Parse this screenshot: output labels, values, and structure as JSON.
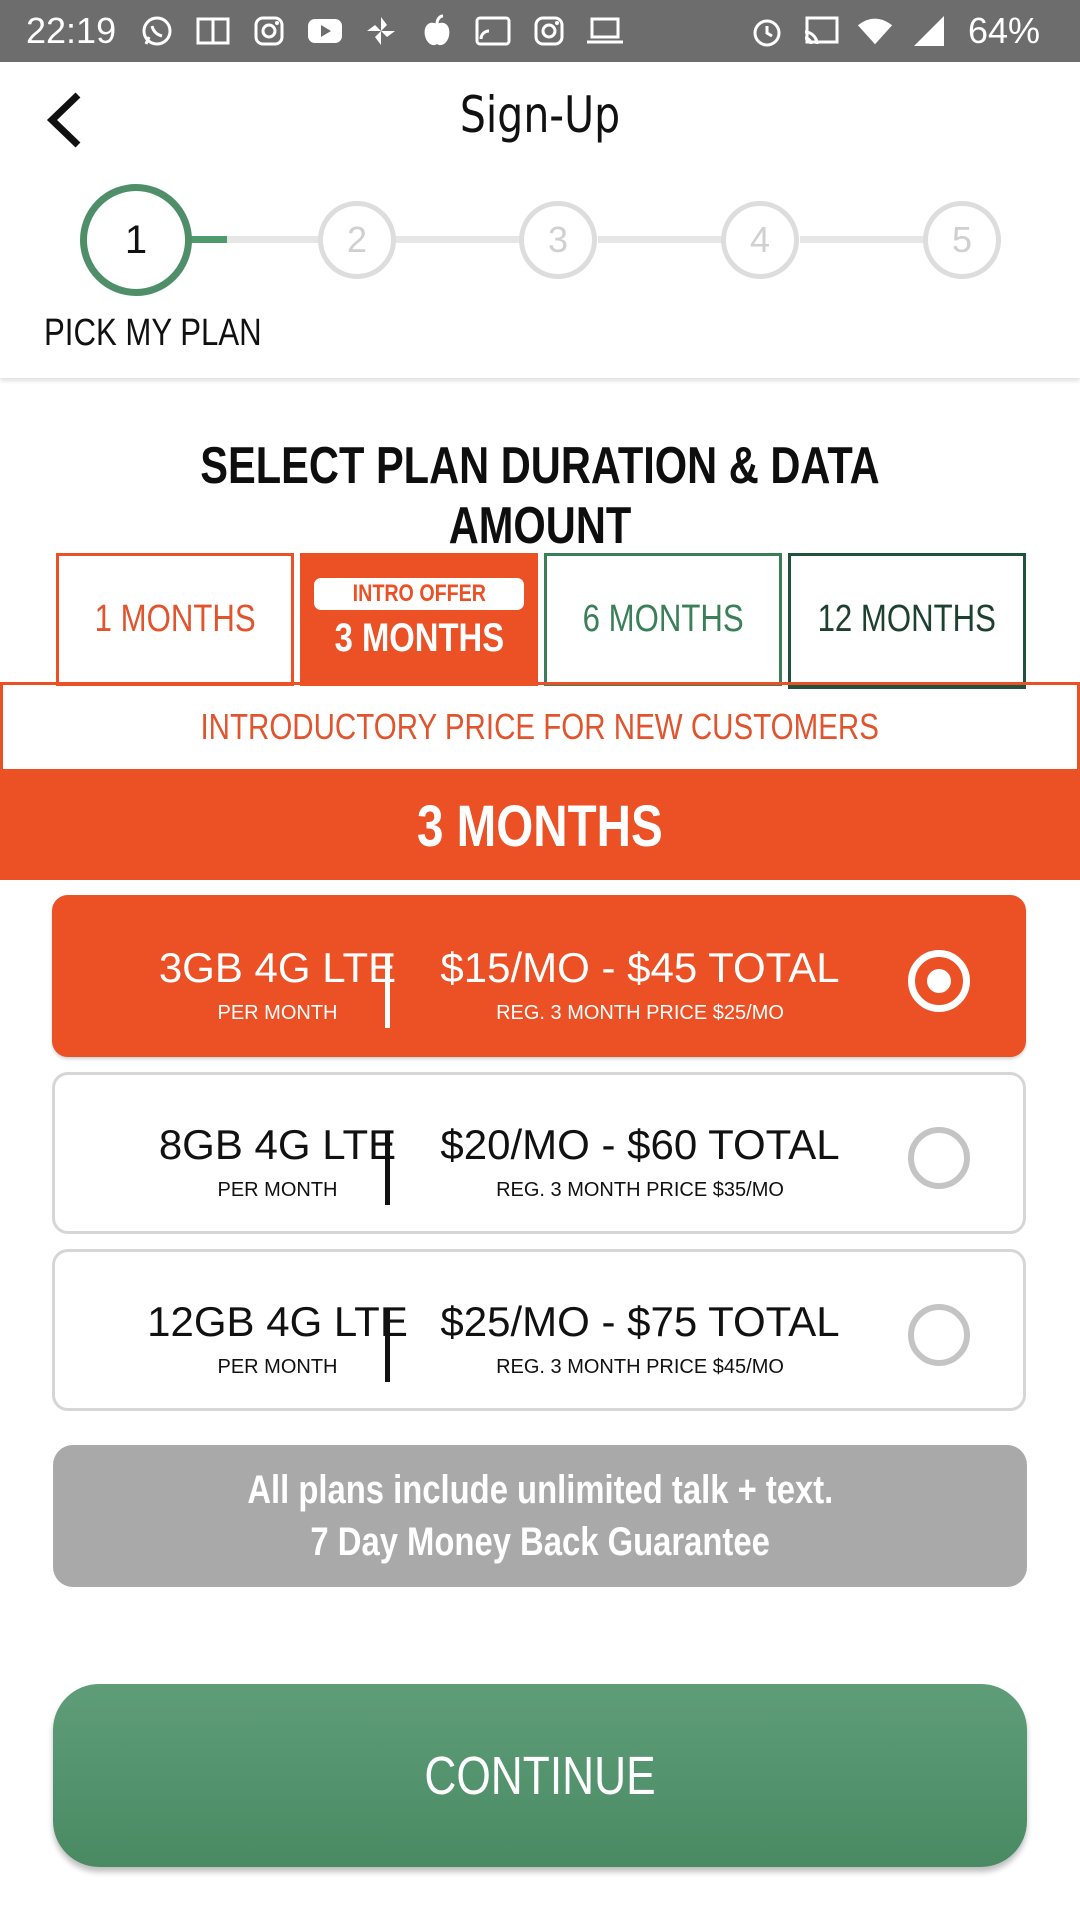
{
  "status_bar": {
    "time": "22:19",
    "battery": "64%",
    "left_icons": [
      "whatsapp-icon",
      "book-icon",
      "instagram-icon",
      "youtube-icon",
      "pinwheel-icon",
      "apple-icon",
      "http-icon",
      "instagram-icon",
      "laptop-icon"
    ],
    "right_icons": [
      "alarm-icon",
      "cast-icon",
      "wifi-icon",
      "signal-icon"
    ]
  },
  "header": {
    "title": "Sign-Up",
    "back_icon": "chevron-left-icon"
  },
  "stepper": {
    "steps": [
      "1",
      "2",
      "3",
      "4",
      "5"
    ],
    "current_step": 1,
    "current_label": "PICK MY PLAN"
  },
  "section": {
    "title": "SELECT PLAN DURATION & DATA AMOUNT"
  },
  "tabs": [
    {
      "label": "1 MONTHS"
    },
    {
      "label": "3 MONTHS",
      "badge": "INTRO OFFER",
      "selected": true
    },
    {
      "label": "6 MONTHS"
    },
    {
      "label": "12 MONTHS"
    }
  ],
  "offer": {
    "note": "INTRODUCTORY PRICE FOR NEW CUSTOMERS",
    "duration": "3 MONTHS"
  },
  "plans": [
    {
      "data": "3GB 4G LTE",
      "per": "PER MONTH",
      "price": "$15/MO - $45 TOTAL",
      "reg": "REG. 3 MONTH PRICE $25/MO",
      "selected": true
    },
    {
      "data": "8GB 4G LTE",
      "per": "PER MONTH",
      "price": "$20/MO - $60 TOTAL",
      "reg": "REG. 3 MONTH PRICE $35/MO",
      "selected": false
    },
    {
      "data": "12GB 4G LTE",
      "per": "PER MONTH",
      "price": "$25/MO - $75 TOTAL",
      "reg": "REG. 3 MONTH PRICE $45/MO",
      "selected": false
    }
  ],
  "info": {
    "line1": "All plans include unlimited talk + text.",
    "line2": "7 Day Money Back Guarantee"
  },
  "continue_label": "CONTINUE",
  "colors": {
    "accent_orange": "#ec5025",
    "accent_green": "#4e8f69",
    "dark_green": "#20523c",
    "info_gray": "#a9a9a9"
  }
}
